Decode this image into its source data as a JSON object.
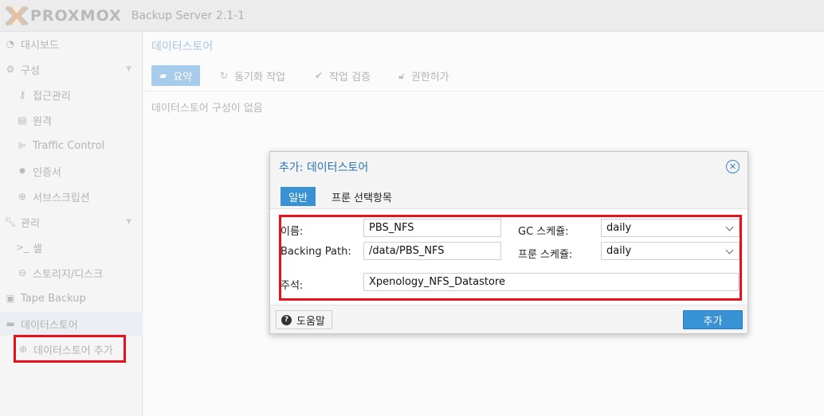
{
  "header": {
    "brand": "PROXMOX",
    "product": "Backup Server 2.1-1"
  },
  "sidebar": {
    "items": [
      {
        "label": "대시보드",
        "icon": "dashboard-icon"
      },
      {
        "label": "구성",
        "icon": "gears-icon"
      },
      {
        "label": "접근관리",
        "icon": "key-icon"
      },
      {
        "label": "원격",
        "icon": "server-icon"
      },
      {
        "label": "Traffic Control",
        "icon": "signal-icon"
      },
      {
        "label": "인증서",
        "icon": "certificate-icon"
      },
      {
        "label": "서브스크립션",
        "icon": "support-icon"
      },
      {
        "label": "관리",
        "icon": "wrench-icon"
      },
      {
        "label": "셸",
        "icon": "terminal-icon"
      },
      {
        "label": "스토리지/디스크",
        "icon": "hdd-icon"
      },
      {
        "label": "Tape Backup",
        "icon": "tape-icon"
      },
      {
        "label": "데이터스토어",
        "icon": "archive-icon"
      },
      {
        "label": "데이터스토어 추가",
        "icon": "plus-circle-icon"
      }
    ]
  },
  "main": {
    "title": "데이터스토어",
    "tabs": [
      {
        "label": "요약",
        "icon": "book-icon"
      },
      {
        "label": "동기화 작업",
        "icon": "refresh-icon"
      },
      {
        "label": "작업 검증",
        "icon": "check-circle-icon"
      },
      {
        "label": "권한허가",
        "icon": "unlock-icon"
      }
    ],
    "empty_message": "데이터스토어 구성이 없음"
  },
  "dialog": {
    "title": "추가: 데이터스토어",
    "tabs": [
      "일반",
      "프룬 선택항목"
    ],
    "fields": {
      "name_label": "이름:",
      "name_value": "PBS_NFS",
      "path_label": "Backing Path:",
      "path_value": "/data/PBS_NFS",
      "gc_label": "GC 스케쥴:",
      "gc_value": "daily",
      "prune_label": "프룬 스케쥴:",
      "prune_value": "daily",
      "comment_label": "주석:",
      "comment_value": "Xpenology_NFS_Datastore"
    },
    "help_label": "도움말",
    "add_label": "추가"
  },
  "colors": {
    "accent": "#3892d4",
    "highlight": "#e8101c",
    "title_blue": "#2c74b8"
  }
}
